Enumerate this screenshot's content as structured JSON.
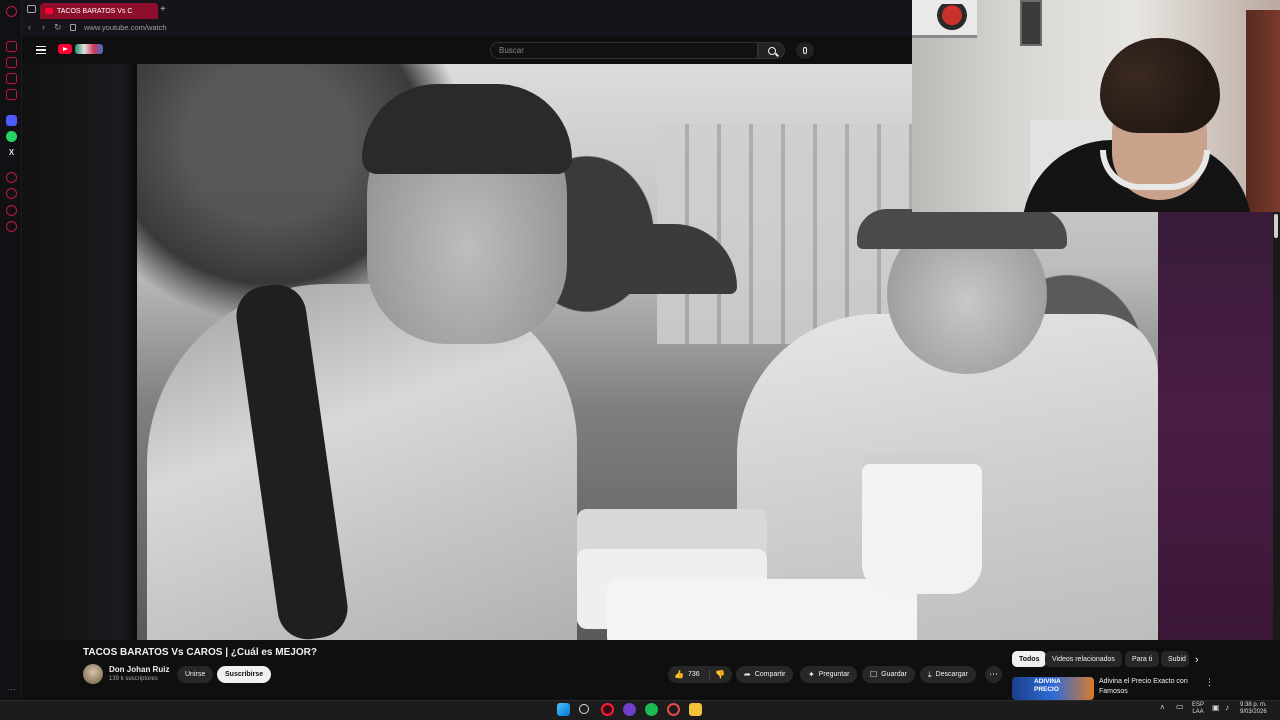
{
  "browser": {
    "tab_title": "TACOS BARATOS Vs C",
    "new_tab_label": "+",
    "url": "www.youtube.com/watch",
    "back_glyph": "‹",
    "forward_glyph": "›",
    "reload_glyph": "↻",
    "sidebar_icons": [
      "opera-logo-icon",
      "home-icon",
      "bookmarks-icon",
      "history-icon",
      "messenger-icon",
      "whatsapp-icon",
      "x-icon",
      "player-icon",
      "clock-icon",
      "extensions-icon",
      "settings-icon"
    ],
    "sidebar_x_glyph": "X",
    "sidebar_more_glyph": "···"
  },
  "youtube": {
    "search_placeholder": "Buscar",
    "video": {
      "title": "TACOS BARATOS Vs CAROS | ¿Cuál es MEJOR?",
      "channel_name": "Don Johan Ruiz",
      "subscribers": "139 k suscriptores",
      "join_label": "Unirse",
      "subscribe_label": "Suscribirse",
      "like_count": "736",
      "like_glyph": "👍",
      "dislike_glyph": "👎",
      "share_glyph": "➦",
      "ask_glyph": "✦",
      "save_glyph": "☐",
      "download_glyph": "⤓",
      "share_label": "Compartir",
      "ask_label": "Preguntar",
      "save_label": "Guardar",
      "download_label": "Descargar",
      "more_glyph": "⋯"
    },
    "chips": [
      "Todos",
      "Videos relacionados",
      "Para ti",
      "Subid"
    ],
    "chips_next_glyph": "›",
    "recommendation": {
      "thumb_text_1": "ADIVINA",
      "thumb_text_2": "PRECIO",
      "title": "Adivina el Precio Exacto con Famosos",
      "more_glyph": "⋮"
    }
  },
  "taskbar": {
    "tray_arrow_glyph": "˄",
    "tray_icons_glyph": "▭",
    "language_1": "ESP",
    "language_2": "LAA",
    "time": "9:38 p. m.",
    "date": "9/03/2026"
  },
  "colors": {
    "brand_red": "#ff0033",
    "opera_tab": "#8e0f2b",
    "background": "#0f0f0f"
  }
}
